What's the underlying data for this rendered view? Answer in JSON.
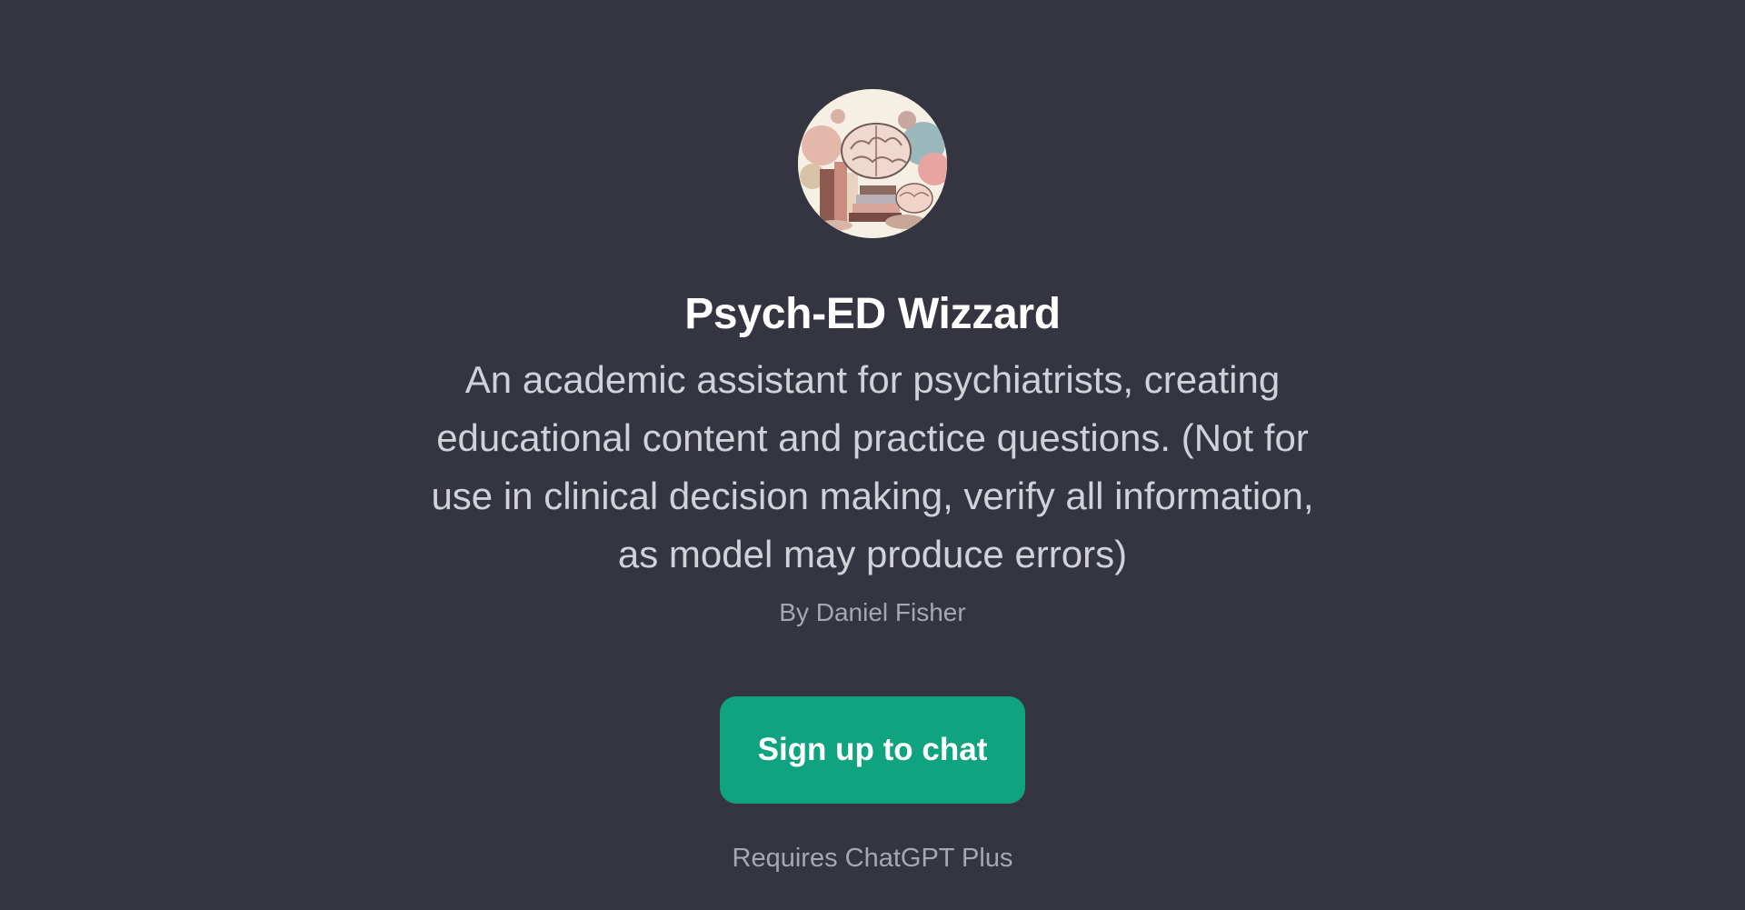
{
  "gpt": {
    "title": "Psych-ED Wizzard",
    "description": "An academic assistant for psychiatrists, creating educational content and practice questions. (Not for use in clinical decision making, verify all information, as model may produce errors)",
    "author": "By Daniel Fisher"
  },
  "actions": {
    "signup_label": "Sign up to chat"
  },
  "footer": {
    "requires": "Requires ChatGPT Plus"
  },
  "icons": {
    "avatar": "brain-books-illustration-icon"
  },
  "colors": {
    "background": "#343541",
    "accent": "#10a37f",
    "title": "#ffffff",
    "muted": "#a7a7b3"
  }
}
